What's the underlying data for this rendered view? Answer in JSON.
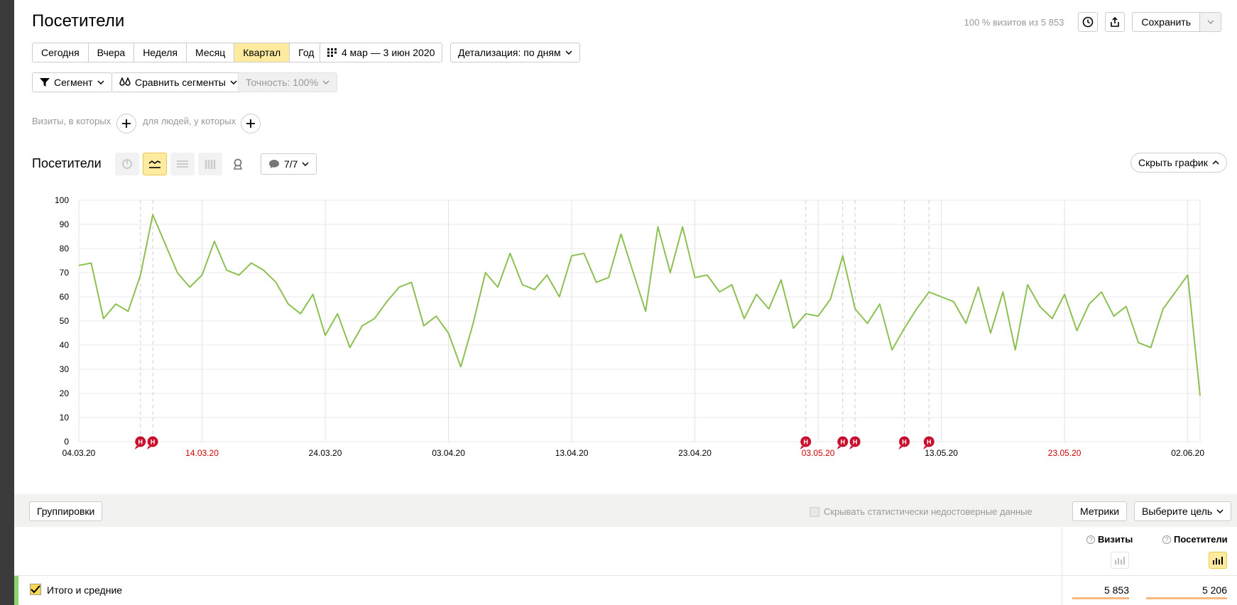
{
  "header": {
    "title": "Посетители",
    "visits_share": "100 % визитов из 5 853",
    "save_label": "Сохранить"
  },
  "period": {
    "tabs": [
      "Сегодня",
      "Вчера",
      "Неделя",
      "Месяц",
      "Квартал",
      "Год"
    ],
    "active": "Квартал",
    "date_range": "4 мар — 3 июн 2020",
    "detail": "Детализация: по дням"
  },
  "segments": {
    "segment_label": "Сегмент",
    "compare_label": "Сравнить сегменты",
    "accuracy_label": "Точность: 100%"
  },
  "conditions": {
    "visits_where": "Визиты, в которых",
    "people_where": "для людей, у которых"
  },
  "chart_section": {
    "title": "Посетители",
    "notes_count": "7/7",
    "hide_label": "Скрыть график"
  },
  "chart_data": {
    "type": "line",
    "ylim": [
      0,
      100
    ],
    "yticks": [
      0,
      10,
      20,
      30,
      40,
      50,
      60,
      70,
      80,
      90,
      100
    ],
    "x_tick_labels": [
      {
        "label": "04.03.20",
        "day": 0,
        "holiday": false
      },
      {
        "label": "14.03.20",
        "day": 10,
        "holiday": true
      },
      {
        "label": "24.03.20",
        "day": 20,
        "holiday": false
      },
      {
        "label": "03.04.20",
        "day": 30,
        "holiday": false
      },
      {
        "label": "13.04.20",
        "day": 40,
        "holiday": false
      },
      {
        "label": "23.04.20",
        "day": 50,
        "holiday": false
      },
      {
        "label": "03.05.20",
        "day": 60,
        "holiday": true
      },
      {
        "label": "13.05.20",
        "day": 70,
        "holiday": false
      },
      {
        "label": "23.05.20",
        "day": 80,
        "holiday": true
      },
      {
        "label": "02.06.20",
        "day": 90,
        "holiday": false
      }
    ],
    "note_marker_label": "Н",
    "note_days": [
      5,
      6,
      59,
      62,
      63,
      67,
      69
    ],
    "color": "#8cc152",
    "values": [
      73,
      74,
      51,
      57,
      54,
      69,
      94,
      82,
      70,
      64,
      69,
      83,
      71,
      69,
      74,
      71,
      66,
      57,
      53,
      61,
      44,
      53,
      39,
      48,
      51,
      58,
      64,
      66,
      48,
      52,
      45,
      31,
      49,
      70,
      64,
      78,
      65,
      63,
      69,
      60,
      77,
      78,
      66,
      68,
      86,
      70,
      54,
      89,
      70,
      89,
      68,
      69,
      62,
      65,
      51,
      61,
      55,
      67,
      47,
      53,
      52,
      59,
      77,
      55,
      49,
      57,
      38,
      47,
      55,
      62,
      60,
      58,
      49,
      64,
      45,
      62,
      38,
      65,
      56,
      51,
      61,
      46,
      57,
      62,
      52,
      56,
      41,
      39,
      55,
      62,
      69,
      19
    ]
  },
  "table": {
    "groupings_label": "Группировки",
    "hide_unreliable": "Скрывать статистически недостоверные данные",
    "metrics_label": "Метрики",
    "goal_label": "Выберите цель",
    "columns": [
      "Визиты",
      "Посетители"
    ],
    "total_label": "Итого и средние",
    "total_values": [
      "5 853",
      "5 206"
    ]
  }
}
